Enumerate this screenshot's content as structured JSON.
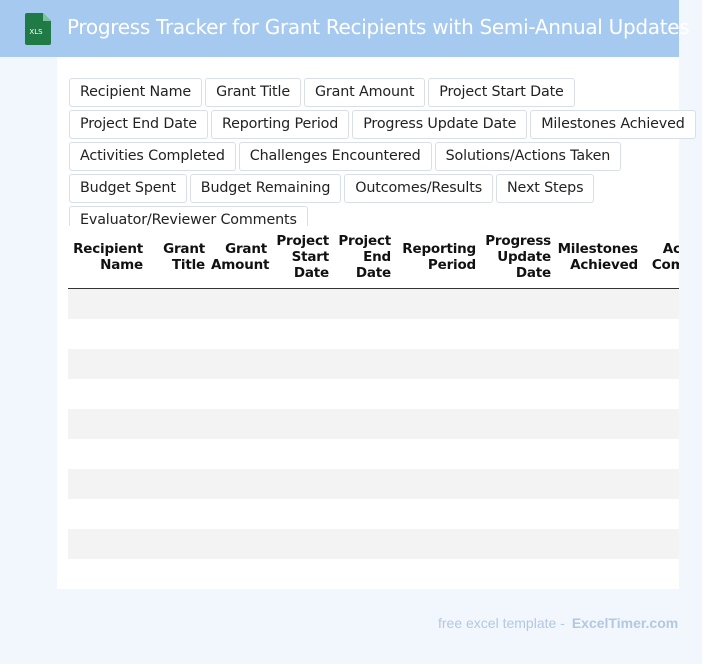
{
  "header": {
    "title": "Progress Tracker for Grant Recipients with Semi-Annual Updates",
    "icon_label": "XLS",
    "icon_color": "#1f7a45"
  },
  "chips": [
    "Recipient Name",
    "Grant Title",
    "Grant Amount",
    "Project Start Date",
    "Project End Date",
    "Reporting Period",
    "Progress Update Date",
    "Milestones Achieved",
    "Activities Completed",
    "Challenges Encountered",
    "Solutions/Actions Taken",
    "Budget Spent",
    "Budget Remaining",
    "Outcomes/Results",
    "Next Steps",
    "Evaluator/Reviewer Comments"
  ],
  "table": {
    "headers": [
      [
        "Recipient",
        "Name"
      ],
      [
        "Grant",
        "Title"
      ],
      [
        "Grant",
        "Amount"
      ],
      [
        "Project",
        "Start",
        "Date"
      ],
      [
        "Project",
        "End",
        "Date"
      ],
      [
        "Reporting",
        "Period"
      ],
      [
        "Progress",
        "Update",
        "Date"
      ],
      [
        "Milestones",
        "Achieved"
      ],
      [
        "Activities",
        "Completed"
      ]
    ],
    "row_count": 10
  },
  "footer": {
    "prefix": "free excel template -",
    "brand": "ExcelTimer.com"
  },
  "colors": {
    "header_bg": "#a6c9ef",
    "page_bg": "#f2f7fd",
    "stripe": "#f3f3f3",
    "footer_text": "#b3c8e0"
  }
}
